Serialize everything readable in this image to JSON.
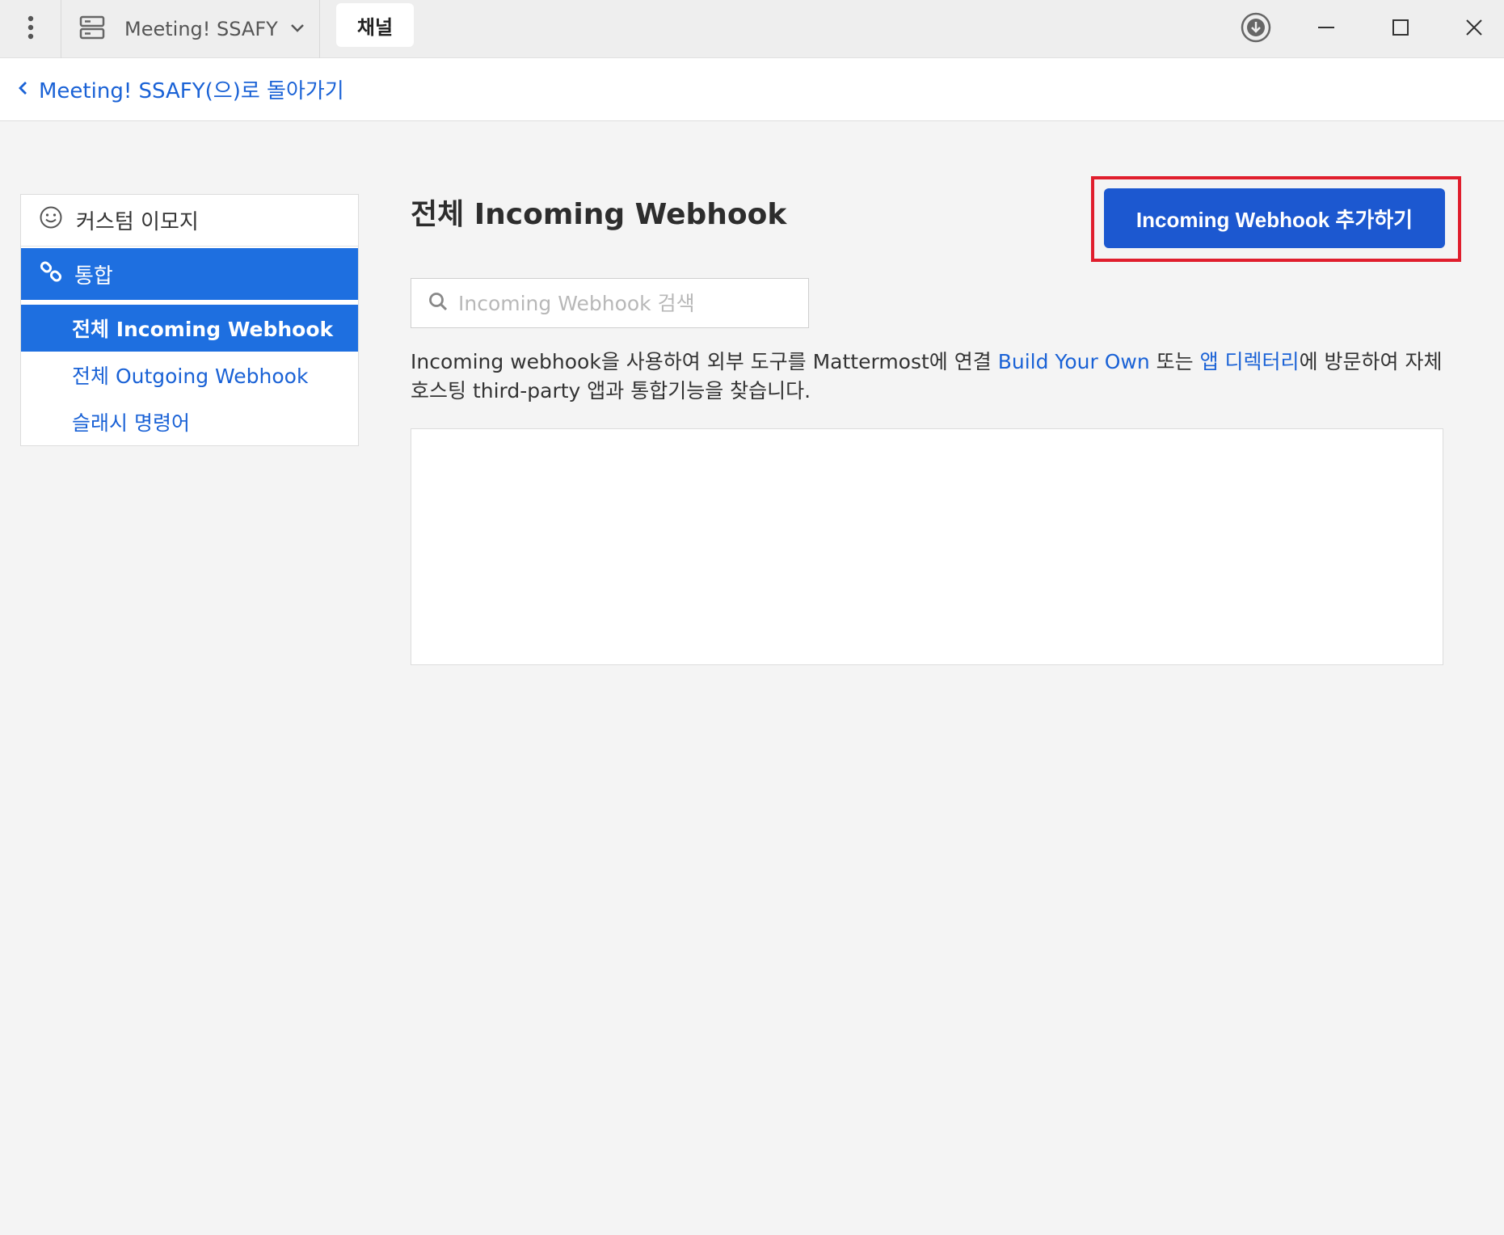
{
  "titlebar": {
    "server_name": "Meeting! SSAFY",
    "tab_label": "채널",
    "icons": [
      "more-vertical-icon",
      "server-icon",
      "chevron-down-icon",
      "download-icon",
      "minimize-icon",
      "maximize-icon",
      "close-icon"
    ]
  },
  "back": {
    "label": "Meeting! SSAFY(으)로 돌아가기"
  },
  "sidebar": {
    "emoji_label": "커스텀 이모지",
    "integrations_label": "통합",
    "sub_items": [
      {
        "label": "전체 Incoming Webhook",
        "active": true
      },
      {
        "label": "전체 Outgoing Webhook",
        "active": false
      },
      {
        "label": "슬래시 명령어",
        "active": false
      }
    ]
  },
  "main": {
    "title": "전체 Incoming Webhook",
    "add_button": "Incoming Webhook 추가하기",
    "search_placeholder": "Incoming Webhook 검색",
    "desc_part1": "Incoming webhook을 사용하여 외부 도구를 Mattermost에 연결 ",
    "desc_link1": "Build Your Own",
    "desc_part2": " 또는 ",
    "desc_link2": "앱 디렉터리",
    "desc_part3": "에 방문하여 자체 호스팅 third-party 앱과 통합기능을 찾습니다."
  },
  "colors": {
    "accent": "#1e6fe0",
    "button": "#1c58d0",
    "link": "#1a62d6",
    "highlight": "#e01e2d"
  }
}
